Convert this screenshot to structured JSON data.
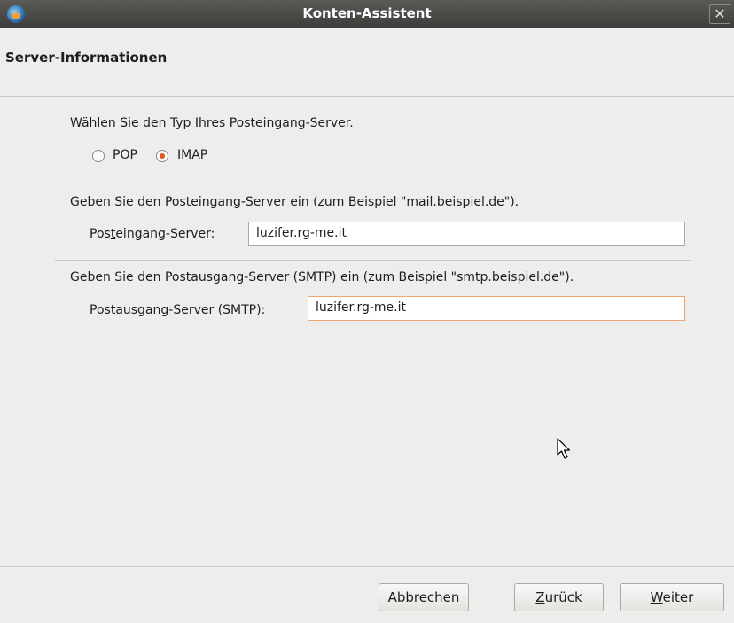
{
  "window": {
    "title": "Konten-Assistent",
    "close_glyph": "✕"
  },
  "header": {
    "heading": "Server-Informationen"
  },
  "server_type": {
    "prompt": "Wählen Sie den Typ Ihres Posteingang-Server.",
    "options": [
      {
        "mnemonic": "P",
        "rest": "OP",
        "selected": false
      },
      {
        "mnemonic": "I",
        "rest": "MAP",
        "selected": true
      }
    ]
  },
  "incoming": {
    "prompt": "Geben Sie den Posteingang-Server ein (zum Beispiel \"mail.beispiel.de\").",
    "label_pre": "Pos",
    "label_mnemonic": "t",
    "label_post": "eingang-Server:",
    "value": "luzifer.rg-me.it"
  },
  "outgoing": {
    "prompt": "Geben Sie den Postausgang-Server (SMTP) ein (zum Beispiel \"smtp.beispiel.de\").",
    "label_pre": "Pos",
    "label_mnemonic": "t",
    "label_post": "ausgang-Server (SMTP):",
    "value": "luzifer.rg-me.it"
  },
  "buttons": {
    "cancel": "Abbrechen",
    "back_mnemonic": "Z",
    "back_rest": "urück",
    "next_mnemonic": "W",
    "next_rest": "eiter"
  }
}
